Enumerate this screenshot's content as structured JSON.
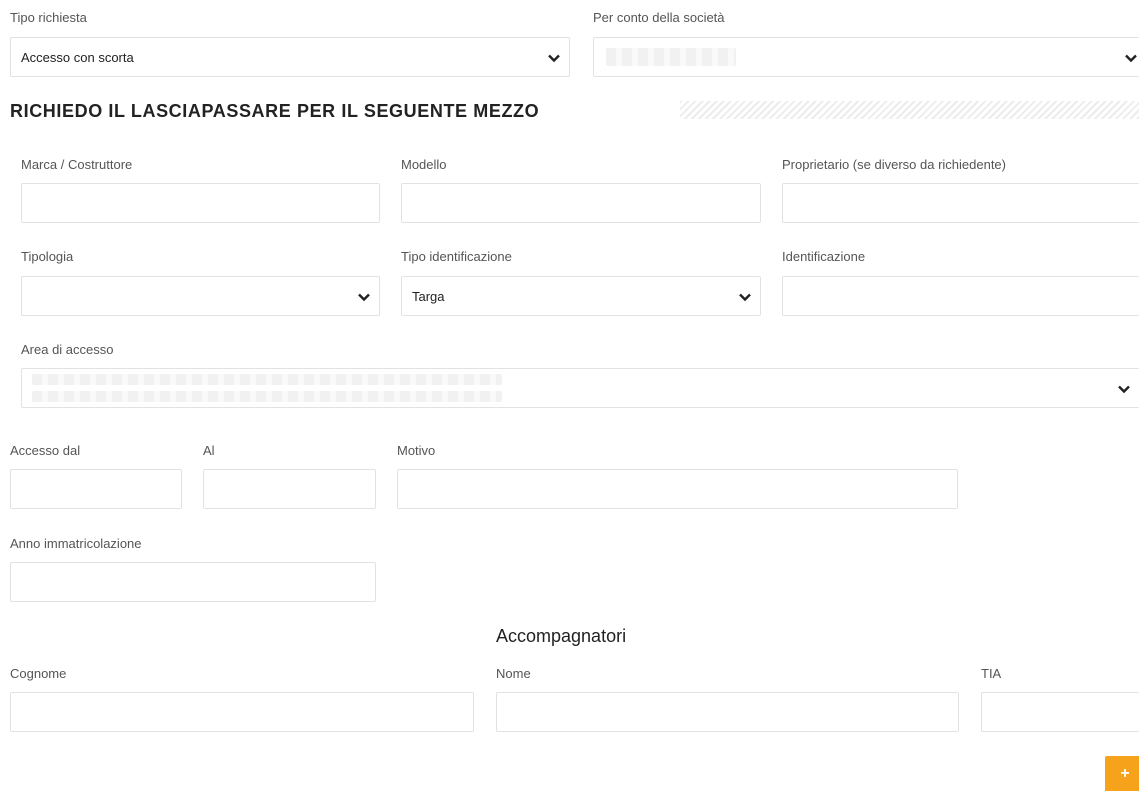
{
  "top": {
    "tipo_richiesta_label": "Tipo richiesta",
    "tipo_richiesta_value": "Accesso con scorta",
    "per_conto_label": "Per conto della società"
  },
  "section": {
    "title": "RICHIEDO IL LASCIAPASSARE PER IL SEGUENTE MEZZO"
  },
  "vehicle": {
    "marca_label": "Marca / Costruttore",
    "modello_label": "Modello",
    "proprietario_label": "Proprietario (se diverso da richiedente)",
    "tipologia_label": "Tipologia",
    "tipologia_value": "",
    "tipo_identificazione_label": "Tipo identificazione",
    "tipo_identificazione_value": "Targa",
    "identificazione_label": "Identificazione",
    "area_label": "Area di accesso"
  },
  "access": {
    "dal_label": "Accesso dal",
    "al_label": "Al",
    "motivo_label": "Motivo",
    "anno_label": "Anno immatricolazione"
  },
  "companions": {
    "title": "Accompagnatori",
    "cognome_label": "Cognome",
    "nome_label": "Nome",
    "tia_label": "TIA",
    "add_label": "+"
  },
  "colors": {
    "accent": "#f7a21b",
    "border": "#e2e2e2",
    "label": "#555555",
    "heading": "#222222"
  },
  "icons": {
    "select_arrow": "chevron-down-icon"
  }
}
